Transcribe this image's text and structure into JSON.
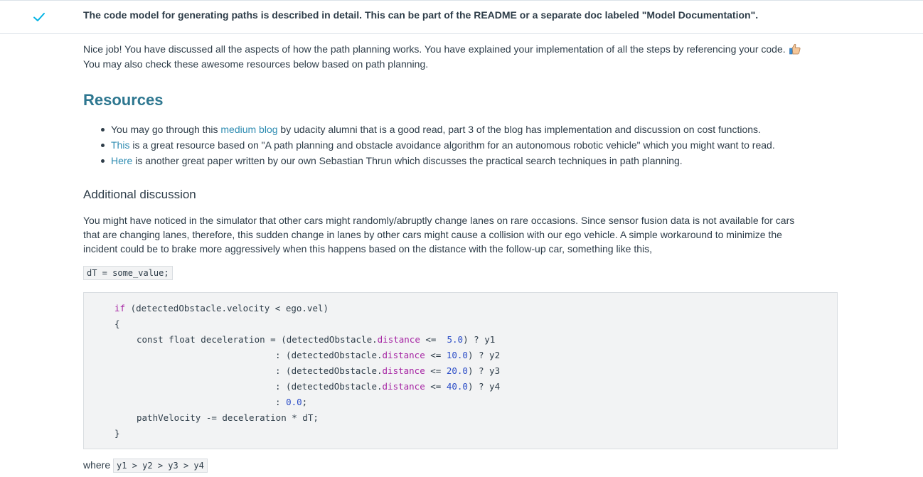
{
  "criteria": {
    "text": "The code model for generating paths is described in detail. This can be part of the README or a separate doc labeled \"Model Documentation\"."
  },
  "feedback": {
    "line1": "Nice job! You have discussed all the aspects of how the path planning works. You have explained your implementation of all the steps by referencing your code.",
    "line2": "You may also check these awesome resources below based on path planning."
  },
  "resources": {
    "heading": "Resources",
    "items": [
      {
        "before": "You may go through this ",
        "link": "medium blog",
        "after": " by udacity alumni that is a good read, part 3 of the blog has implementation and discussion on cost functions."
      },
      {
        "before": "",
        "link": "This",
        "after": " is a great resource based on \"A path planning and obstacle avoidance algorithm for an autonomous robotic vehicle\" which you might want to read."
      },
      {
        "before": "",
        "link": "Here",
        "after": " is another great paper written by our own Sebastian Thrun which discusses the practical search techniques in path planning."
      }
    ]
  },
  "discussion": {
    "heading": "Additional discussion",
    "line1": "You might have noticed in the simulator that other cars might randomly/abruptly change lanes on rare occasions. Since sensor fusion data is not available for cars",
    "line2": "that are changing lanes, therefore, this sudden change in lanes by other cars might cause a collision with our ego vehicle. A simple workaround to minimize the",
    "line3": "incident could be to brake more aggressively when this happens based on the distance with the follow-up car, something like this,",
    "inline_code": "dT = some_value;",
    "where_label": "where",
    "where_code": "y1 > y2 > y3 > y4"
  },
  "code": {
    "if_kw": "if",
    "if_rest": " (detectedObstacle.velocity < ego.vel)",
    "open_brace": "{",
    "const_prefix": "const float deceleration = (detectedObstacle.",
    "cond_prefix": ": (detectedObstacle.",
    "prop": "distance",
    "op": " <= ",
    "rows": [
      {
        "num": " 5.0",
        "result": ") ? y1"
      },
      {
        "num": "10.0",
        "result": ") ? y2"
      },
      {
        "num": "20.0",
        "result": ") ? y3"
      },
      {
        "num": "40.0",
        "result": ") ? y4"
      }
    ],
    "default_prefix": ": ",
    "default_num": "0.0",
    "default_suffix": ";",
    "path_line": "pathVelocity -= deceleration * dT;",
    "close_brace": "}"
  },
  "colors": {
    "check": "#02b3e4",
    "heading": "#2e7790",
    "link": "#2d8bb1",
    "keyword": "#a626a4",
    "number": "#2b4dc7"
  },
  "icons": {
    "status": "check-icon",
    "emoji": "thumbs-up-icon"
  }
}
